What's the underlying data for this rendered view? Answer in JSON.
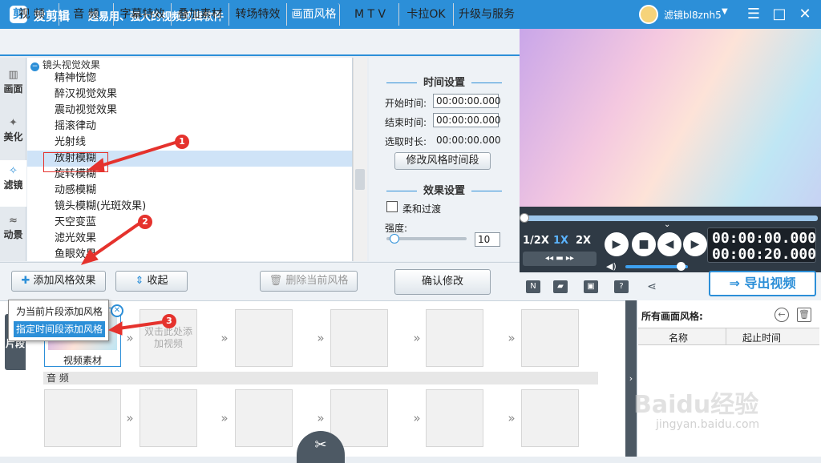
{
  "app": {
    "name": "爱剪辑",
    "logo_char": "剪",
    "tagline": "超易用、强大的视频剪辑软件",
    "username": "滤镜bl8znh5"
  },
  "window_controls": {
    "menu": "☰",
    "minimize": "—",
    "maximize": "□",
    "close": "✕"
  },
  "tabs": [
    "视 频",
    "音 频",
    "字幕特效",
    "叠加素材",
    "转场特效",
    "画面风格",
    "M T V",
    "卡拉OK",
    "升级与服务"
  ],
  "active_tab": "画面风格",
  "left_nav": [
    {
      "label": "画面",
      "icon": "film-icon",
      "active": false
    },
    {
      "label": "美化",
      "icon": "magic-wand-icon",
      "active": false
    },
    {
      "label": "滤镜",
      "icon": "filter-wand-icon",
      "active": true
    },
    {
      "label": "动景",
      "icon": "wave-icon",
      "active": false
    }
  ],
  "effects": {
    "group_label": "镜头视觉效果",
    "items": [
      "精神恍惚",
      "醉汉视觉效果",
      "震动视觉效果",
      "摇滚律动",
      "光射线",
      "放射模糊",
      "旋转模糊",
      "动感模糊",
      "镜头模糊(光斑效果)",
      "天空变蓝",
      "滤光效果",
      "鱼眼效果"
    ],
    "selected": "放射模糊"
  },
  "time_settings": {
    "title": "时间设置",
    "start_label": "开始时间:",
    "start_value": "00:00:00.000",
    "end_label": "结束时间:",
    "end_value": "00:00:00.000",
    "duration_label": "选取时长:",
    "duration_value": "00:00:00.000",
    "modify_button": "修改风格时间段"
  },
  "effect_settings": {
    "title": "效果设置",
    "smooth_label": "柔和过渡",
    "smooth_checked": false,
    "strength_label": "强度:",
    "strength_value": "10",
    "slider_level": 0.1
  },
  "lower_buttons": {
    "add_style": "添加风格效果",
    "collapse": "收起",
    "delete_style": "删除当前风格",
    "confirm": "确认修改"
  },
  "popup_menu": {
    "items": [
      "为当前片段添加风格",
      "指定时间段添加风格"
    ],
    "highlighted": "指定时间段添加风格"
  },
  "player": {
    "speeds": [
      "1/2X",
      "1X",
      "2X"
    ],
    "active_speed": "1X",
    "current_time": "00:00:00.000",
    "total_time": "00:00:20.000",
    "volume_level": 0.9,
    "playback_progress": 0.0
  },
  "toolbar_icons": [
    "new-icon",
    "folder-open-icon",
    "save-icon",
    "help-icon",
    "share-icon"
  ],
  "export_button": "导出视频",
  "timeline": {
    "segment_tab": "片段",
    "video_clip_label": "视频素材",
    "add_video_hint": "双击此处添加视频",
    "audio_label": "音 频",
    "cut_icon": "✂"
  },
  "styles_panel": {
    "title": "所有画面风格:",
    "col_name": "名称",
    "col_time": "起止时间"
  },
  "annotations": {
    "badge1": "1",
    "badge2": "2",
    "badge3": "3",
    "color": "#e5322d"
  },
  "watermark": {
    "text": "Baidu经验",
    "sub": "jingyan.baidu.com"
  },
  "colors": {
    "accent": "#2c8fd8",
    "dark_panel": "#2f3a45",
    "selected_row": "#cfe3f7"
  }
}
